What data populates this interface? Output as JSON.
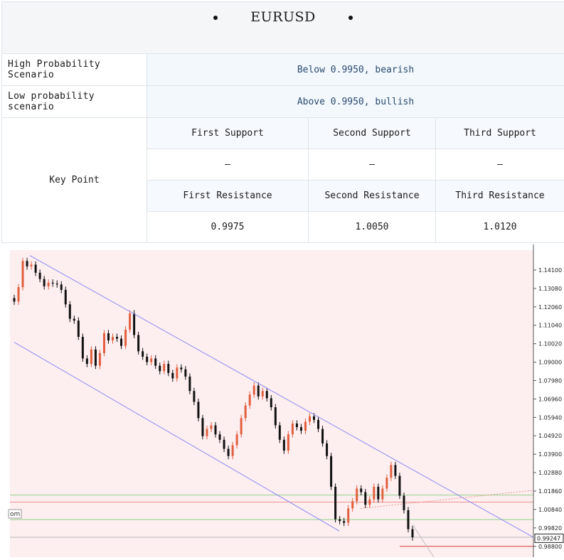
{
  "title": "EURUSD",
  "scenarios": [
    {
      "label": "High Probability Scenario",
      "value": "Below 0.9950, bearish"
    },
    {
      "label": "Low probability scenario",
      "value": "Above 0.9950, bullish"
    }
  ],
  "key_point": {
    "label": "Key Point",
    "support_headers": [
      "First Support",
      "Second Support",
      "Third Support"
    ],
    "support_values": [
      "–",
      "–",
      "–"
    ],
    "resistance_headers": [
      "First Resistance",
      "Second Resistance",
      "Third Resistance"
    ],
    "resistance_values": [
      "0.9975",
      "1.0050",
      "1.0120"
    ]
  },
  "chart_data": {
    "type": "candlestick",
    "ylim": [
      0.982,
      1.152
    ],
    "y_ticks": [
      "1.14100",
      "1.13080",
      "1.12060",
      "1.11040",
      "1.10020",
      "1.09000",
      "1.07980",
      "1.06960",
      "1.05940",
      "1.04920",
      "1.03900",
      "1.02880",
      "1.01860",
      "1.00840",
      "0.99820",
      "0.98800"
    ],
    "current_price": "0.99247",
    "left_label": "om",
    "closes": [
      1.1235,
      1.1315,
      1.146,
      1.143,
      1.144,
      1.1395,
      1.136,
      1.132,
      1.134,
      1.1335,
      1.133,
      1.13,
      1.122,
      1.114,
      1.113,
      1.104,
      1.092,
      1.089,
      1.097,
      1.088,
      1.095,
      1.106,
      1.102,
      1.104,
      1.103,
      1.099,
      1.108,
      1.117,
      1.105,
      1.096,
      1.093,
      1.09,
      1.092,
      1.088,
      1.085,
      1.089,
      1.084,
      1.081,
      1.087,
      1.086,
      1.082,
      1.074,
      1.068,
      1.059,
      1.049,
      1.053,
      1.055,
      1.05,
      1.047,
      1.042,
      1.038,
      1.044,
      1.05,
      1.059,
      1.066,
      1.072,
      1.077,
      1.071,
      1.074,
      1.07,
      1.065,
      1.055,
      1.047,
      1.041,
      1.05,
      1.056,
      1.054,
      1.052,
      1.057,
      1.06,
      1.058,
      1.053,
      1.045,
      1.038,
      1.021,
      1.003,
      1.002,
      1.001,
      1.009,
      1.013,
      1.02,
      1.018,
      1.011,
      1.014,
      1.021,
      1.014,
      1.02,
      1.026,
      1.033,
      1.027,
      1.016,
      1.008,
      0.9975,
      0.993
    ],
    "channel_upper": [
      [
        0,
        1.144
      ],
      [
        1.0,
        0.992
      ]
    ],
    "channel_lower": [
      [
        0,
        1.101
      ],
      [
        1.0,
        0.9925
      ]
    ],
    "horizontal_lines": [
      {
        "value": 1.0125,
        "color": "#e8948c"
      },
      {
        "value": 1.0164,
        "color": "#8fd38a"
      },
      {
        "value": 1.0028,
        "color": "#8fd38a"
      },
      {
        "value": 0.993,
        "color": "#b8b8b8"
      },
      {
        "value": 0.988,
        "color": "#dd3a3a"
      }
    ],
    "colors": {
      "up": "#e15f3f",
      "down": "#111111",
      "channel": "#8a8cf0",
      "background": "#fdeef0"
    }
  }
}
